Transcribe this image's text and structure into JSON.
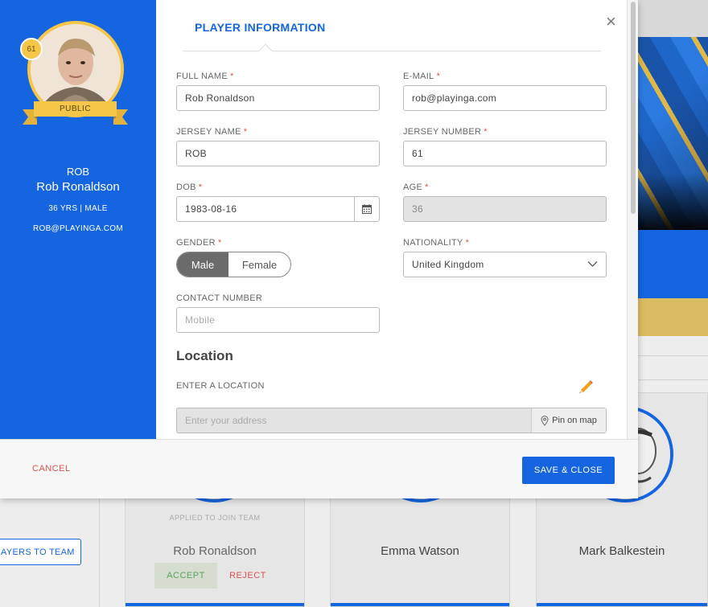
{
  "modal": {
    "tab_title": "PLAYER INFORMATION",
    "close_symbol": "×",
    "required_marker": "*"
  },
  "sidebar": {
    "jersey_number_badge": "61",
    "visibility_ribbon": "PUBLIC",
    "short_name": "ROB",
    "full_name": "Rob Ronaldson",
    "meta": "36 YRS | MALE",
    "email": "ROB@PLAYINGA.COM"
  },
  "form": {
    "full_name": {
      "label": "FULL NAME",
      "value": "Rob Ronaldson"
    },
    "email": {
      "label": "E-MAIL",
      "value": "rob@playinga.com"
    },
    "jersey_name": {
      "label": "JERSEY NAME",
      "value": "ROB"
    },
    "jersey_number": {
      "label": "JERSEY NUMBER",
      "value": "61"
    },
    "dob": {
      "label": "DOB",
      "value": "1983-08-16"
    },
    "age": {
      "label": "AGE",
      "value": "36"
    },
    "gender": {
      "label": "GENDER",
      "options": [
        "Male",
        "Female"
      ],
      "selected": "Male"
    },
    "nationality": {
      "label": "NATIONALITY",
      "value": "United Kingdom"
    },
    "contact": {
      "label": "CONTACT NUMBER",
      "placeholder": "Mobile"
    }
  },
  "location": {
    "heading": "Location",
    "label": "ENTER A LOCATION",
    "placeholder": "Enter your address",
    "pin_label": "Pin on map"
  },
  "footer": {
    "cancel_label": "CANCEL",
    "save_label": "SAVE & CLOSE"
  },
  "background": {
    "add_button_label": "AYERS TO TEAM",
    "cards": [
      {
        "status": "APPLIED TO JOIN TEAM",
        "name": "Rob Ronaldson",
        "accept": "ACCEPT",
        "reject": "REJECT"
      },
      {
        "name": "Emma Watson"
      },
      {
        "name": "Mark Balkestein"
      }
    ]
  },
  "colors": {
    "brand_blue": "#1565e0",
    "gold": "#f5c648",
    "danger": "#d9534f"
  }
}
